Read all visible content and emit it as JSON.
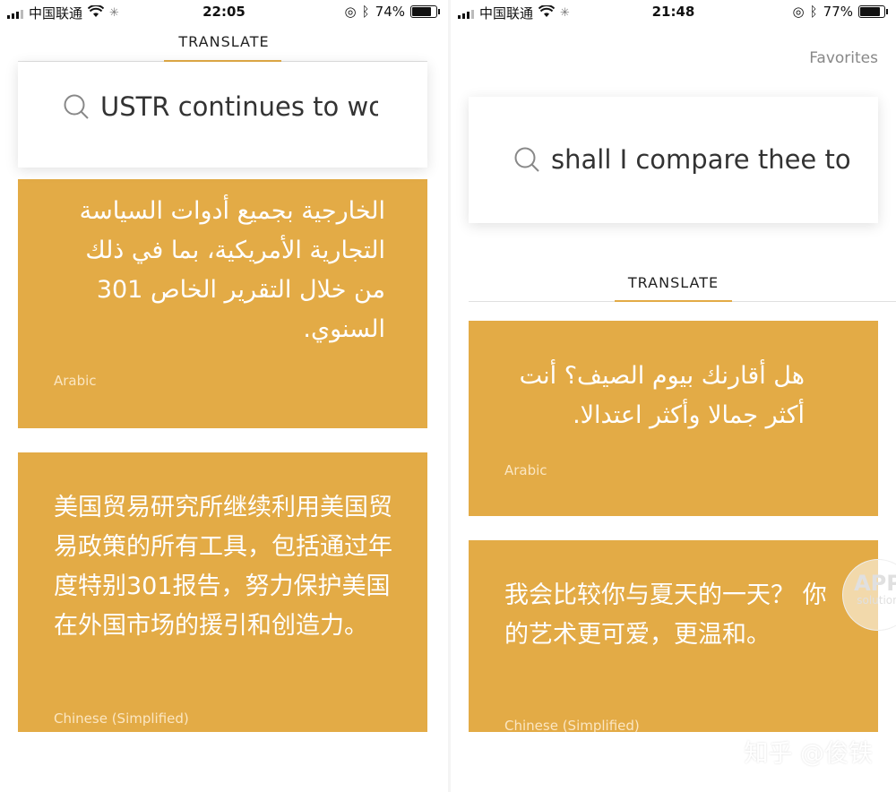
{
  "left": {
    "status": {
      "carrier": "中国联通",
      "time": "22:05",
      "battery": "74%",
      "battery_level": 0.74
    },
    "tab": "TRANSLATE",
    "search_query": "USTR continues to wor",
    "cards": [
      {
        "text": "الخارجية بجميع أدوات السياسة التجارية الأمريكية، بما في ذلك من خلال التقرير الخاص 301 السنوي.",
        "language": "Arabic"
      },
      {
        "text": "美国贸易研究所继续利用美国贸易政策的所有工具，包括通过年度特别301报告，努力保护美国在外国市场的援引和创造力。",
        "language": "Chinese (Simplified)"
      }
    ]
  },
  "right": {
    "status": {
      "carrier": "中国联通",
      "time": "21:48",
      "battery": "77%",
      "battery_level": 0.77
    },
    "favorites": "Favorites",
    "search_query": "shall I compare thee to",
    "tab": "TRANSLATE",
    "cards": [
      {
        "text": "هل أقارنك بيوم الصيف؟ أنت أكثر جمالا وأكثر اعتدالا.",
        "language": "Arabic"
      },
      {
        "text": "我会比较你与夏天的一天？ 你的艺术更可爱，更温和。",
        "language": "Chinese (Simplified)"
      }
    ]
  },
  "badge": {
    "title": "APP",
    "subtitle": "solution"
  },
  "watermark": "知乎 @俊铁",
  "colors": {
    "accent": "#e3ab46",
    "background": "#ffffff"
  }
}
